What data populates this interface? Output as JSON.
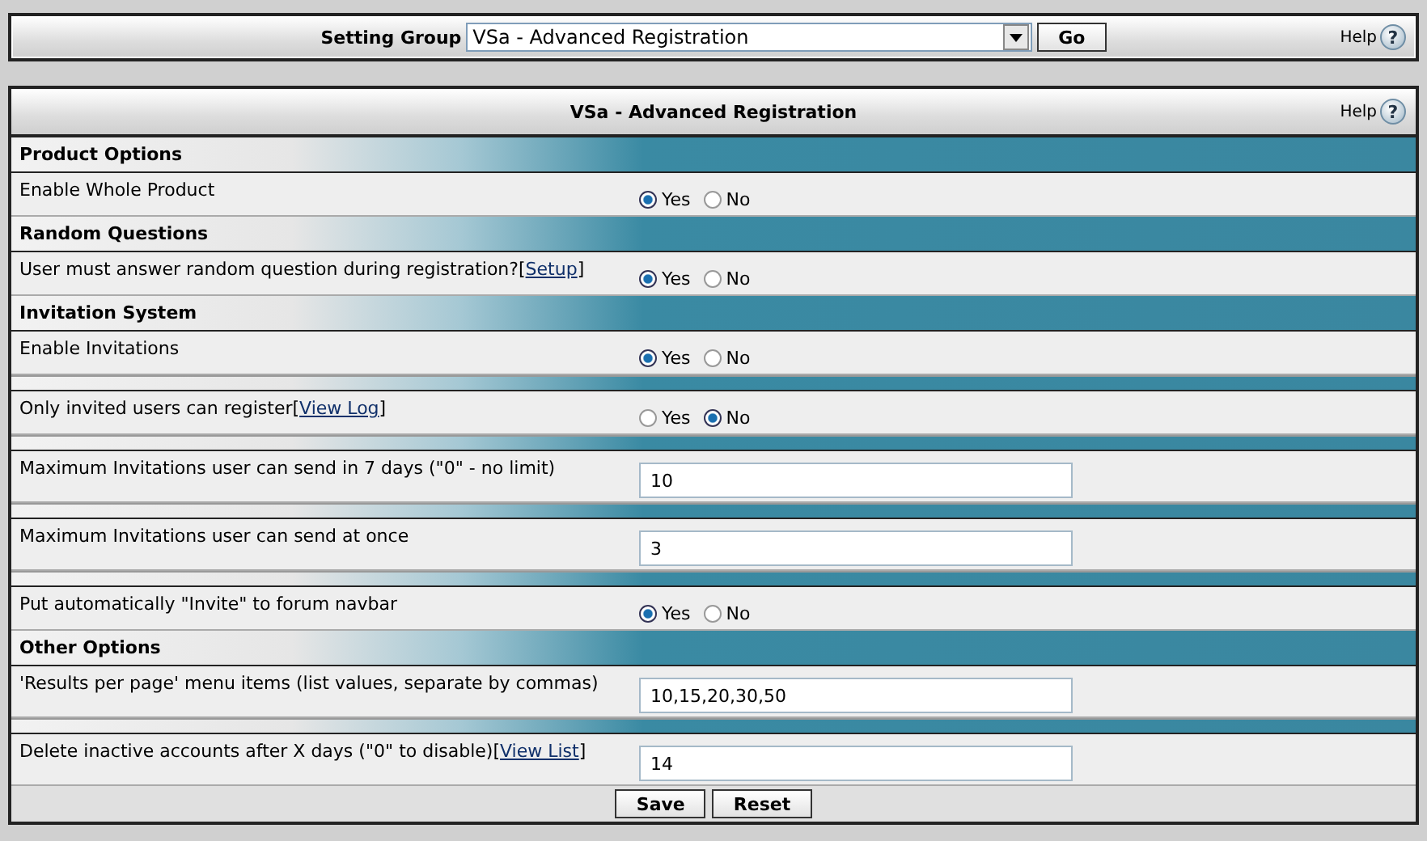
{
  "setting_bar": {
    "label": "Setting Group",
    "select_value": "VSa - Advanced Registration",
    "go_button": "Go",
    "help": "Help",
    "help_icon": "?"
  },
  "panel": {
    "title": "VSa - Advanced Registration",
    "help": "Help",
    "help_icon": "?"
  },
  "sections": [
    {
      "title": "Product Options",
      "settings": [
        {
          "kind": "radio",
          "label": "Enable Whole Product",
          "options": [
            {
              "label": "Yes",
              "selected": true
            },
            {
              "label": "No",
              "selected": false
            }
          ]
        }
      ]
    },
    {
      "title": "Random Questions",
      "settings": [
        {
          "kind": "radio",
          "label": "User must answer random question during registration?",
          "link": {
            "open": "[",
            "text": "Setup",
            "close": "]"
          },
          "options": [
            {
              "label": "Yes",
              "selected": true
            },
            {
              "label": "No",
              "selected": false
            }
          ]
        }
      ]
    },
    {
      "title": "Invitation System",
      "settings": [
        {
          "kind": "radio",
          "label": "Enable Invitations",
          "options": [
            {
              "label": "Yes",
              "selected": true
            },
            {
              "label": "No",
              "selected": false
            }
          ]
        },
        {
          "kind": "radio",
          "label": "Only invited users can register",
          "link": {
            "open": "[",
            "text": "View Log",
            "close": "]"
          },
          "options": [
            {
              "label": "Yes",
              "selected": false
            },
            {
              "label": "No",
              "selected": true
            }
          ]
        },
        {
          "kind": "text",
          "label": "Maximum Invitations user can send in 7 days (\"0\" - no limit)",
          "value": "10"
        },
        {
          "kind": "text",
          "label": "Maximum Invitations user can send at once",
          "value": "3"
        },
        {
          "kind": "radio",
          "label": "Put automatically \"Invite\" to forum navbar",
          "options": [
            {
              "label": "Yes",
              "selected": true
            },
            {
              "label": "No",
              "selected": false
            }
          ]
        }
      ]
    },
    {
      "title": "Other Options",
      "settings": [
        {
          "kind": "text",
          "label": "'Results per page' menu items (list values, separate by commas)",
          "value": "10,15,20,30,50"
        },
        {
          "kind": "text",
          "label": "Delete inactive accounts after X days (\"0\" to disable)",
          "link": {
            "open": "[",
            "text": "View List",
            "close": "]"
          },
          "value": "14"
        }
      ]
    }
  ],
  "buttons": [
    "Save",
    "Reset"
  ]
}
